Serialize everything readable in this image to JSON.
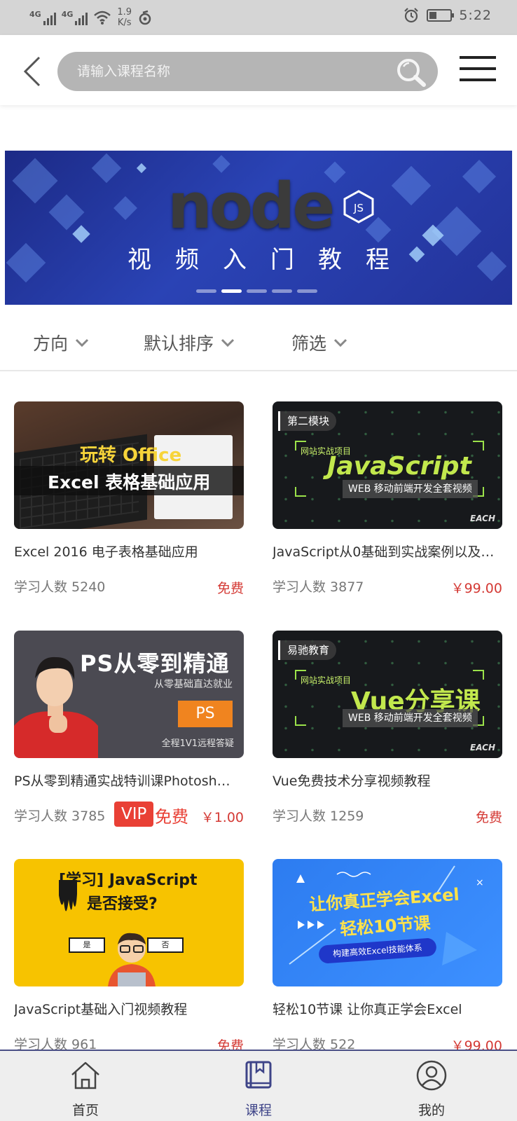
{
  "status_bar": {
    "network1": "4G",
    "network2": "4G",
    "speed_value": "1.9",
    "speed_unit": "K/s",
    "time": "5:22"
  },
  "header": {
    "search_placeholder": "请输入课程名称"
  },
  "banner": {
    "logo_text": "node",
    "logo_badge": "JS",
    "subtitle": "视频入门教程",
    "slide_count": 5,
    "active_slide": 2
  },
  "filters": [
    {
      "label": "方向"
    },
    {
      "label": "默认排序"
    },
    {
      "label": "筛选"
    }
  ],
  "courses": [
    {
      "title": "Excel 2016 电子表格基础应用",
      "learners": "学习人数 5240",
      "price": "免费",
      "thumb_line1": "玩转 Office",
      "thumb_line2": "Excel 表格基础应用"
    },
    {
      "title": "JavaScript从0基础到实战案例以及…",
      "learners": "学习人数 3877",
      "price": "￥99.00",
      "thumb_tag": "第二模块",
      "thumb_project": "网站实战项目",
      "thumb_main": "JavaScript",
      "thumb_sub": "WEB 移动前端开发全套视频",
      "thumb_brand": "EACH"
    },
    {
      "title": "PS从零到精通实战特训课Photosh…",
      "learners": "学习人数 3785",
      "vip": "VIP",
      "vip_free": "免费",
      "price": "￥1.00",
      "thumb_title": "PS从零到精通",
      "thumb_sub": "从零基础直达就业",
      "thumb_box": "PS",
      "thumb_foot": "全程1V1远程答疑"
    },
    {
      "title": "Vue免费技术分享视频教程",
      "learners": "学习人数 1259",
      "price": "免费",
      "thumb_tag": "易驰教育",
      "thumb_project": "网站实战项目",
      "thumb_main": "Vue分享课",
      "thumb_sub": "WEB 移动前端开发全套视频",
      "thumb_brand": "EACH"
    },
    {
      "title": "JavaScript基础入门视频教程",
      "learners": "学习人数 961",
      "price": "免费",
      "thumb_line1": "[学习] JavaScript",
      "thumb_line2": "是否接受?",
      "thumb_yes": "是",
      "thumb_no": "否"
    },
    {
      "title": "轻松10节课 让你真正学会Excel",
      "learners": "学习人数 522",
      "price": "￥99.00",
      "thumb_line1": "让你真正学会Excel",
      "thumb_line2": "轻松10节课",
      "thumb_pill": "构建高效Excel技能体系"
    }
  ],
  "tabs": [
    {
      "label": "首页",
      "icon": "home-icon"
    },
    {
      "label": "课程",
      "icon": "book-icon"
    },
    {
      "label": "我的",
      "icon": "user-icon"
    }
  ],
  "colors": {
    "accent": "#3e4488",
    "price_red": "#d43a35",
    "vip_red": "#e94035"
  }
}
